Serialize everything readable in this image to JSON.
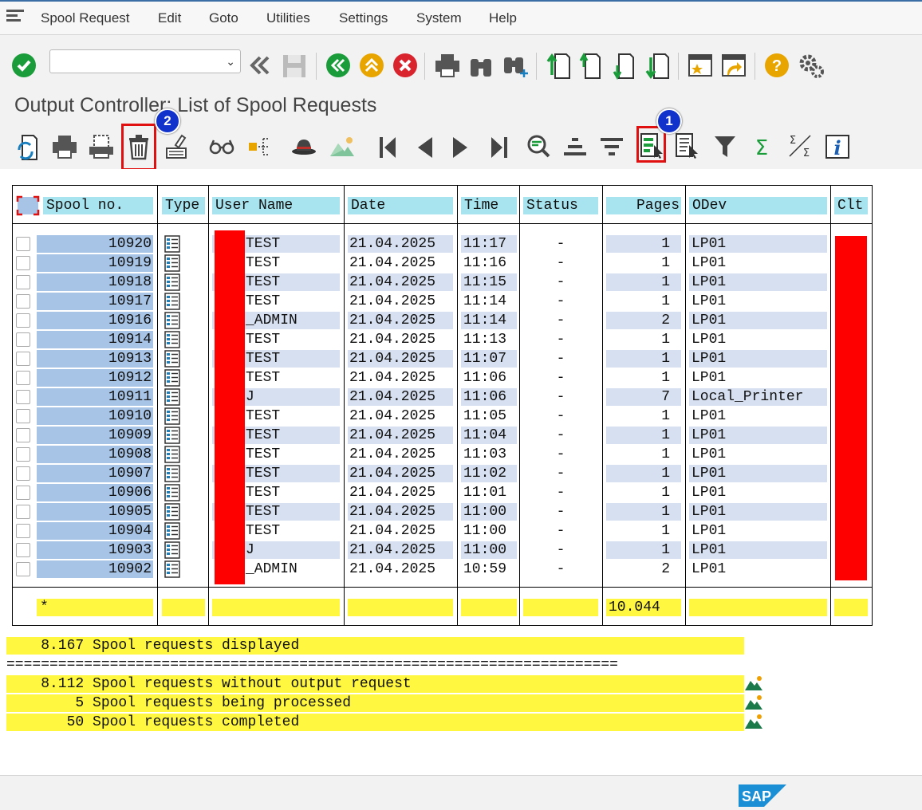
{
  "menu": {
    "items": [
      {
        "label": "Spool Request"
      },
      {
        "label": "Edit"
      },
      {
        "label": "Goto"
      },
      {
        "label": "Utilities"
      },
      {
        "label": "Settings"
      },
      {
        "label": "System"
      },
      {
        "label": "Help"
      }
    ]
  },
  "page_title": "Output Controller: List of Spool Requests",
  "badges": {
    "one": "1",
    "two": "2"
  },
  "columns": {
    "spool_no": "Spool no.",
    "type": "Type",
    "user_name": "User Name",
    "date": "Date",
    "time": "Time",
    "status": "Status",
    "pages": "Pages",
    "odev": "ODev",
    "clt": "Clt"
  },
  "rows": [
    {
      "spool": "10920",
      "user": "TEST",
      "date": "21.04.2025",
      "time": "11:17",
      "status": "-",
      "pages": "1",
      "odev": "LP01"
    },
    {
      "spool": "10919",
      "user": "TEST",
      "date": "21.04.2025",
      "time": "11:16",
      "status": "-",
      "pages": "1",
      "odev": "LP01"
    },
    {
      "spool": "10918",
      "user": "TEST",
      "date": "21.04.2025",
      "time": "11:15",
      "status": "-",
      "pages": "1",
      "odev": "LP01"
    },
    {
      "spool": "10917",
      "user": "TEST",
      "date": "21.04.2025",
      "time": "11:14",
      "status": "-",
      "pages": "1",
      "odev": "LP01"
    },
    {
      "spool": "10916",
      "user": "_ADMIN",
      "date": "21.04.2025",
      "time": "11:14",
      "status": "-",
      "pages": "2",
      "odev": "LP01"
    },
    {
      "spool": "10914",
      "user": "TEST",
      "date": "21.04.2025",
      "time": "11:13",
      "status": "-",
      "pages": "1",
      "odev": "LP01"
    },
    {
      "spool": "10913",
      "user": "TEST",
      "date": "21.04.2025",
      "time": "11:07",
      "status": "-",
      "pages": "1",
      "odev": "LP01"
    },
    {
      "spool": "10912",
      "user": "TEST",
      "date": "21.04.2025",
      "time": "11:06",
      "status": "-",
      "pages": "1",
      "odev": "LP01"
    },
    {
      "spool": "10911",
      "user": "J",
      "date": "21.04.2025",
      "time": "11:06",
      "status": "-",
      "pages": "7",
      "odev": "Local_Printer"
    },
    {
      "spool": "10910",
      "user": "TEST",
      "date": "21.04.2025",
      "time": "11:05",
      "status": "-",
      "pages": "1",
      "odev": "LP01"
    },
    {
      "spool": "10909",
      "user": "TEST",
      "date": "21.04.2025",
      "time": "11:04",
      "status": "-",
      "pages": "1",
      "odev": "LP01"
    },
    {
      "spool": "10908",
      "user": "TEST",
      "date": "21.04.2025",
      "time": "11:03",
      "status": "-",
      "pages": "1",
      "odev": "LP01"
    },
    {
      "spool": "10907",
      "user": "TEST",
      "date": "21.04.2025",
      "time": "11:02",
      "status": "-",
      "pages": "1",
      "odev": "LP01"
    },
    {
      "spool": "10906",
      "user": "TEST",
      "date": "21.04.2025",
      "time": "11:01",
      "status": "-",
      "pages": "1",
      "odev": "LP01"
    },
    {
      "spool": "10905",
      "user": "TEST",
      "date": "21.04.2025",
      "time": "11:00",
      "status": "-",
      "pages": "1",
      "odev": "LP01"
    },
    {
      "spool": "10904",
      "user": "TEST",
      "date": "21.04.2025",
      "time": "11:00",
      "status": "-",
      "pages": "1",
      "odev": "LP01"
    },
    {
      "spool": "10903",
      "user": "J",
      "date": "21.04.2025",
      "time": "11:00",
      "status": "-",
      "pages": "1",
      "odev": "LP01"
    },
    {
      "spool": "10902",
      "user": "_ADMIN",
      "date": "21.04.2025",
      "time": "10:59",
      "status": "-",
      "pages": "2",
      "odev": "LP01"
    }
  ],
  "totals": {
    "spool": "*",
    "pages": "10.044"
  },
  "summary": {
    "displayed": "    8.167 Spool requests displayed",
    "separator": "=======================================================================",
    "without_output": "    8.112 Spool requests without output request",
    "processing": "        5 Spool requests being processed",
    "completed": "       50 Spool requests completed"
  },
  "colors": {
    "accent_red": "#e01010",
    "badge_blue": "#1133cc",
    "header_cyan": "#a8e4ef",
    "total_yellow": "#fff740"
  },
  "icons": [
    "enter-check-icon",
    "back-icon",
    "save-icon",
    "exit-icon",
    "up-icon",
    "cancel-icon",
    "print-icon",
    "find-icon",
    "find-next-icon",
    "first-page-icon",
    "prev-page-icon",
    "next-page-icon",
    "last-page-icon",
    "new-session-icon",
    "shortcut-icon",
    "help-icon",
    "customize-icon",
    "refresh-icon",
    "print-directly-icon",
    "print-attributes-icon",
    "delete-icon",
    "edit-icon",
    "display-contents-icon",
    "display-overview-icon",
    "hat-icon",
    "graphics-icon",
    "sort-ascending-icon",
    "sort-descending-icon",
    "choose-layout-icon",
    "select-layout-icon",
    "filter-icon",
    "sum-icon",
    "subtotal-icon",
    "info-icon",
    "sap-logo"
  ]
}
